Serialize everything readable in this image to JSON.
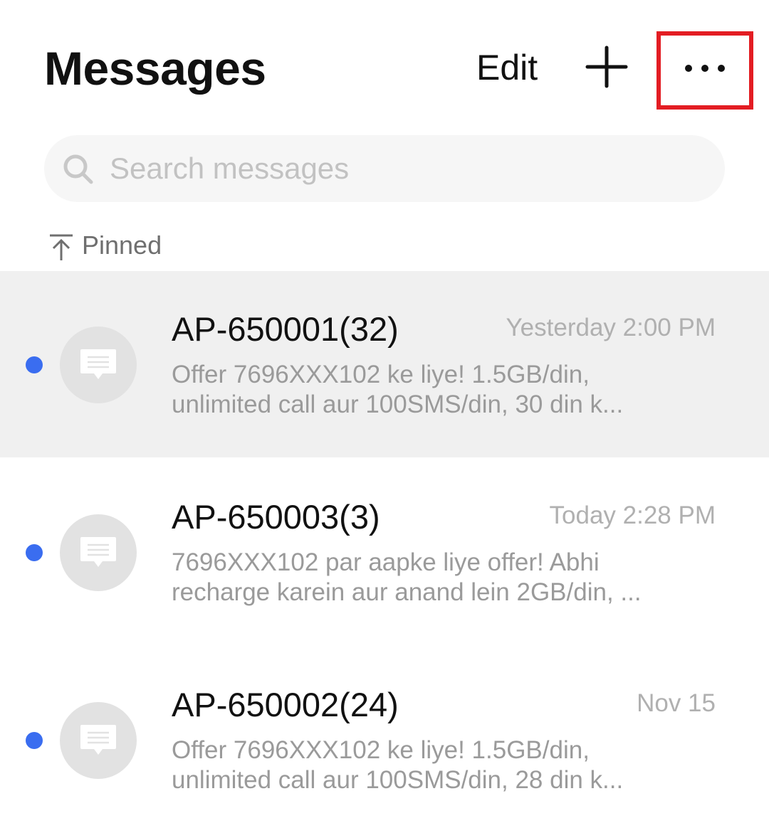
{
  "header": {
    "title": "Messages",
    "edit_label": "Edit",
    "add_icon": "plus-icon",
    "more_icon": "more-horizontal-icon",
    "highlight_color": "#e31d23"
  },
  "search": {
    "placeholder": "Search messages",
    "value": "",
    "icon": "search-icon"
  },
  "pinned": {
    "label": "Pinned",
    "icon": "pin-to-top-icon"
  },
  "conversations": [
    {
      "sender": "AP-650001(32)",
      "time": "Yesterday 2:00 PM",
      "preview_line1": "Offer 7696XXX102 ke liye! 1.5GB/din,",
      "preview_line2": "unlimited call aur 100SMS/din, 30 din k...",
      "unread": true,
      "pinned": true
    },
    {
      "sender": "AP-650003(3)",
      "time": "Today 2:28 PM",
      "preview_line1": "7696XXX102 par aapke liye offer! Abhi",
      "preview_line2": "recharge karein aur anand lein 2GB/din, ...",
      "unread": true,
      "pinned": false
    },
    {
      "sender": "AP-650002(24)",
      "time": "Nov 15",
      "preview_line1": "Offer 7696XXX102 ke liye! 1.5GB/din,",
      "preview_line2": "unlimited call aur 100SMS/din, 28 din k...",
      "unread": true,
      "pinned": false
    }
  ],
  "colors": {
    "unread_dot": "#3a6df0",
    "pinned_row_bg": "#f0f0f0",
    "avatar_bg": "#e2e2e2"
  }
}
